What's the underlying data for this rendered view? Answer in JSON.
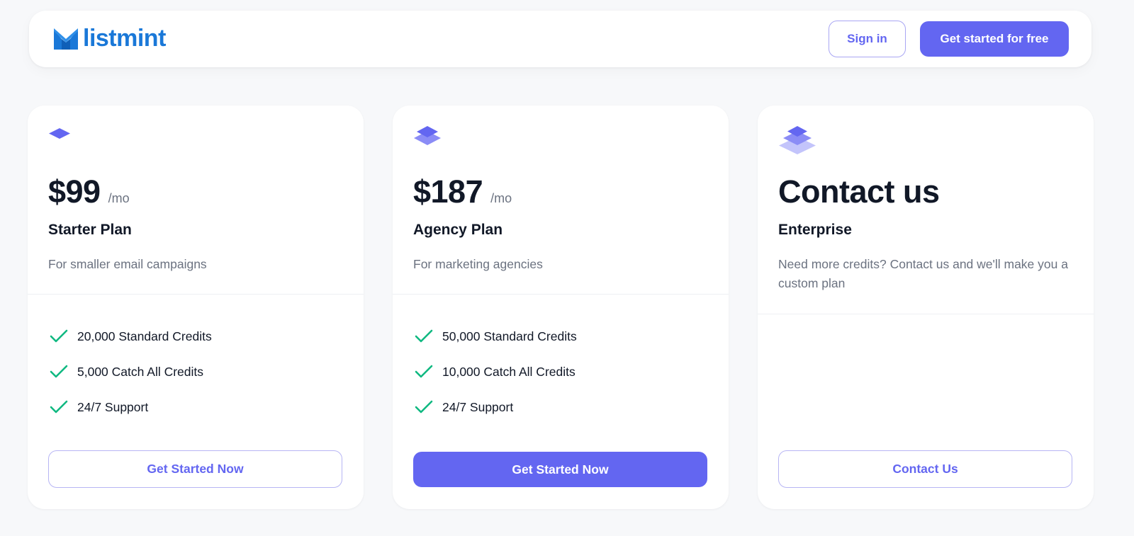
{
  "brand": {
    "name": "listmint",
    "logo_icon": "envelope-logo-icon",
    "color": "#1a78d8"
  },
  "nav": {
    "signin_label": "Sign in",
    "cta_label": "Get started for free"
  },
  "colors": {
    "accent": "#6366f1",
    "check": "#10b981",
    "text": "#111827",
    "muted": "#6b7280",
    "background": "#f7f8fa"
  },
  "plans": [
    {
      "icon": "single-layer-icon",
      "price": "$99",
      "period": "/mo",
      "name": "Starter Plan",
      "description": "For smaller email campaigns",
      "features": [
        "20,000 Standard Credits",
        "5,000 Catch All Credits",
        "24/7 Support"
      ],
      "button_label": "Get Started Now",
      "button_style": "outline"
    },
    {
      "icon": "double-layer-icon",
      "price": "$187",
      "period": "/mo",
      "name": "Agency Plan",
      "description": "For marketing agencies",
      "features": [
        "50,000 Standard Credits",
        "10,000 Catch All Credits",
        "24/7 Support"
      ],
      "button_label": "Get Started Now",
      "button_style": "solid"
    },
    {
      "icon": "triple-layer-icon",
      "title": "Contact us",
      "name": "Enterprise",
      "description": "Need more credits? Contact us and we'll make you a custom plan",
      "features": [],
      "button_label": "Contact Us",
      "button_style": "outline"
    }
  ]
}
